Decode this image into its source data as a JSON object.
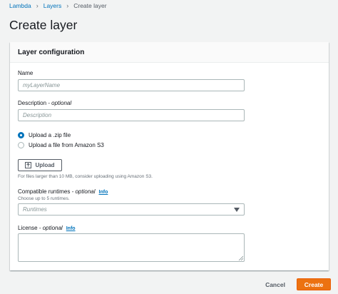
{
  "breadcrumb": {
    "items": [
      "Lambda",
      "Layers"
    ],
    "current": "Create layer"
  },
  "page": {
    "title": "Create layer"
  },
  "panel": {
    "header": "Layer configuration"
  },
  "name": {
    "label": "Name",
    "placeholder": "myLayerName",
    "value": ""
  },
  "description": {
    "label": "Description",
    "optional": " - optional",
    "placeholder": "Description",
    "value": ""
  },
  "upload_options": [
    {
      "label": "Upload a .zip file",
      "selected": true
    },
    {
      "label": "Upload a file from Amazon S3",
      "selected": false
    }
  ],
  "upload": {
    "button_label": "Upload",
    "icon": "upload-icon",
    "hint": "For files larger than 10 MB, consider uploading using Amazon S3."
  },
  "runtimes": {
    "label": "Compatible runtimes",
    "optional": " - optional",
    "info": "Info",
    "hint": "Choose up to 5 runtimes.",
    "placeholder": "Runtimes"
  },
  "license": {
    "label": "License",
    "optional": " - optional",
    "info": "Info",
    "value": ""
  },
  "footer": {
    "cancel_label": "Cancel",
    "create_label": "Create"
  },
  "colors": {
    "link": "#0073bb",
    "primary": "#ec7211",
    "background": "#f2f3f3"
  }
}
